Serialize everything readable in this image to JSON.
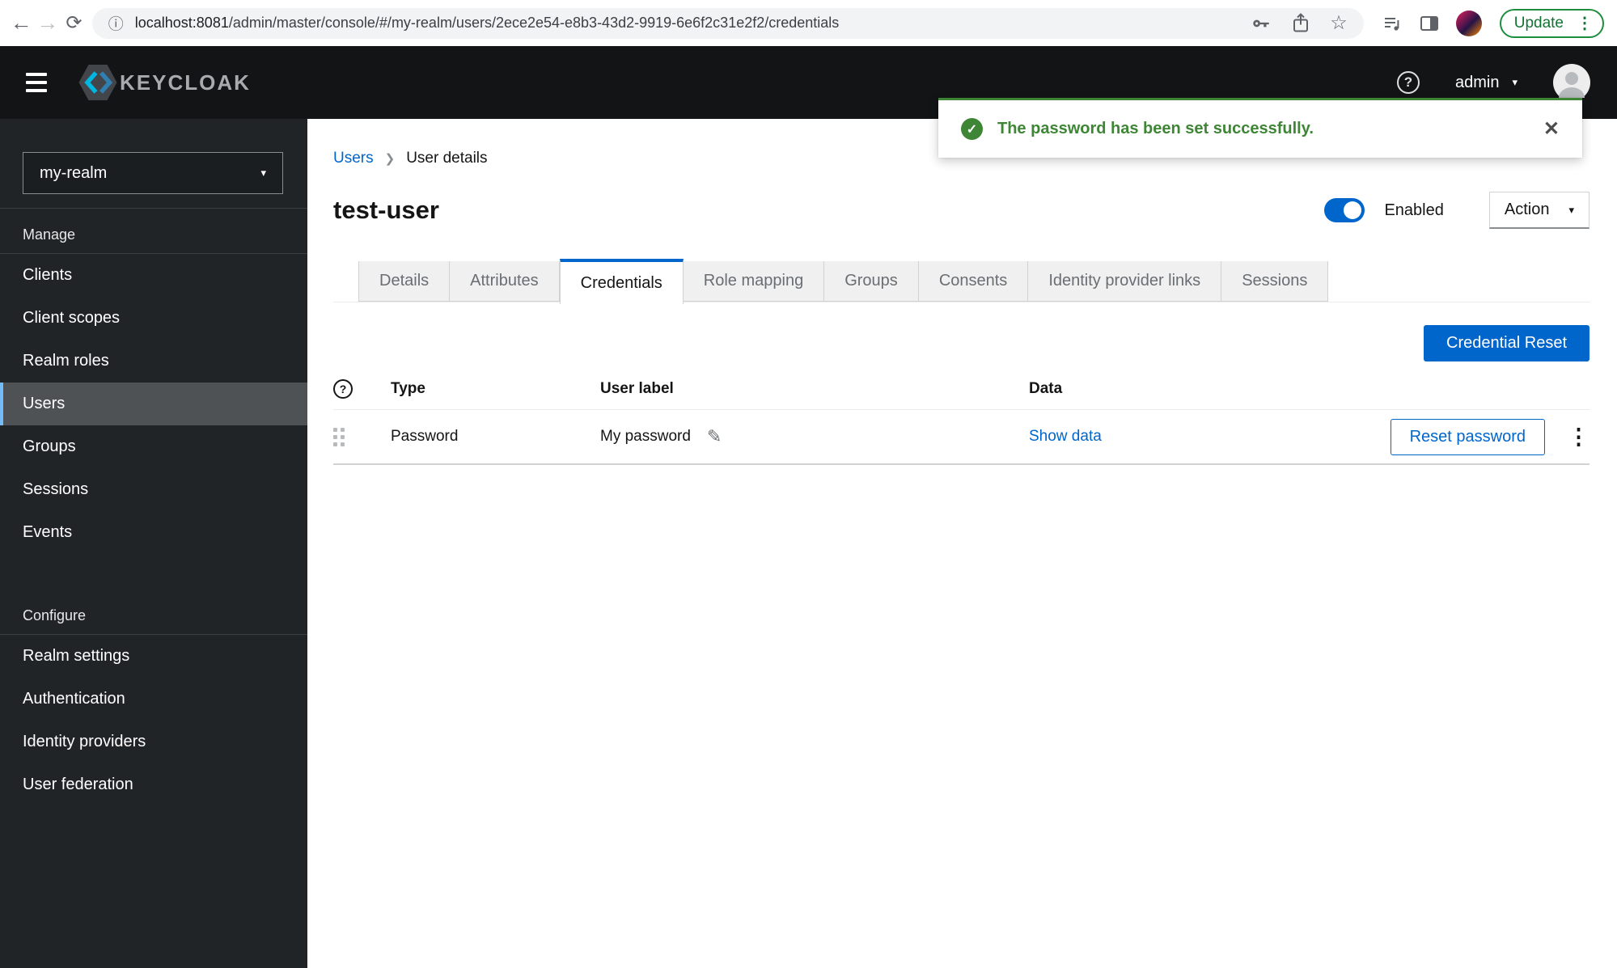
{
  "colors": {
    "primary": "#0066cc",
    "success_green": "#3e8635",
    "nav_accent": "#73bcf7",
    "chrome_update_green": "#137333"
  },
  "browser": {
    "url_host": "localhost",
    "url_port": ":8081",
    "url_path": "/admin/master/console/#/my-realm/users/2ece2e54-e8b3-43d2-9919-6e6f2c31e2f2/credentials",
    "update_label": "Update"
  },
  "masthead": {
    "brand": "KEYCLOAK",
    "username": "admin",
    "help_glyph": "?"
  },
  "sidebar": {
    "realm": "my-realm",
    "manage": {
      "label": "Manage",
      "items": [
        "Clients",
        "Client scopes",
        "Realm roles",
        "Users",
        "Groups",
        "Sessions",
        "Events"
      ]
    },
    "configure": {
      "label": "Configure",
      "items": [
        "Realm settings",
        "Authentication",
        "Identity providers",
        "User federation"
      ]
    }
  },
  "alert": {
    "message": "The password has been set successfully.",
    "close_glyph": "✕",
    "check_glyph": "✓"
  },
  "page": {
    "breadcrumb": {
      "parent": "Users",
      "current": "User details"
    },
    "title": "test-user",
    "enabled_label": "Enabled",
    "action_label": "Action",
    "credential_reset_label": "Credential Reset"
  },
  "tabs": [
    "Details",
    "Attributes",
    "Credentials",
    "Role mapping",
    "Groups",
    "Consents",
    "Identity provider links",
    "Sessions"
  ],
  "active_tab": "Credentials",
  "table": {
    "headers": {
      "type": "Type",
      "user_label": "User label",
      "data": "Data",
      "help_glyph": "?"
    },
    "row": {
      "type": "Password",
      "user_label": "My password",
      "data_link": "Show data",
      "action": "Reset password"
    }
  }
}
